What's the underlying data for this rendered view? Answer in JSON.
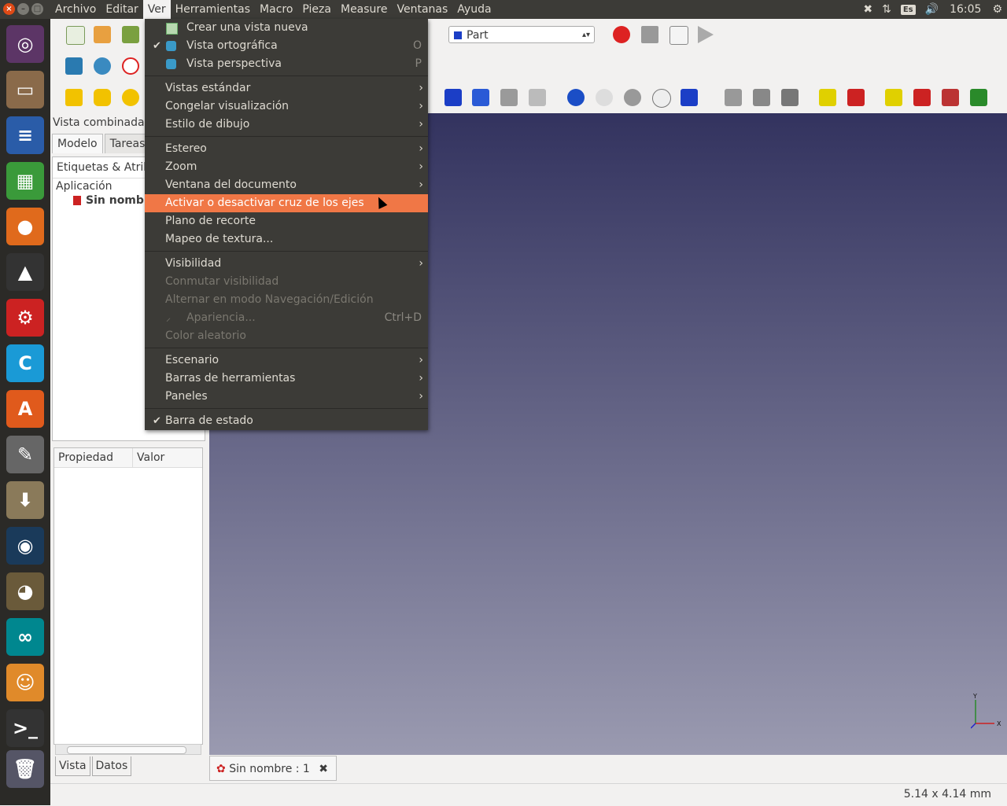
{
  "menubar": {
    "items": [
      "Archivo",
      "Editar",
      "Ver",
      "Herramientas",
      "Macro",
      "Pieza",
      "Measure",
      "Ventanas",
      "Ayuda"
    ],
    "open_item": "Ver"
  },
  "window_controls": {
    "close": "×",
    "minimize": "–",
    "maximize": "□"
  },
  "tray": {
    "keyboard": "Es",
    "clock": "16:05"
  },
  "workbench": {
    "selected": "Part"
  },
  "left_panel": {
    "title": "Vista combinada",
    "tabs": [
      "Modelo",
      "Tareas"
    ],
    "tree_header": "Etiquetas & Atributos",
    "app_label": "Aplicación",
    "doc_label": "Sin nombre",
    "props_headers": [
      "Propiedad",
      "Valor"
    ],
    "bottom_tabs": [
      "Vista",
      "Datos"
    ]
  },
  "doc_tab": {
    "label": "Sin nombre : 1",
    "close": "✖"
  },
  "status": {
    "dimensions": "5.14 x 4.14 mm"
  },
  "axis": {
    "y": "Y",
    "x": "X"
  },
  "ver_menu": [
    {
      "label": "Crear una vista nueva",
      "icon": "new-view-icon"
    },
    {
      "label": "Vista ortográfica",
      "checked": true,
      "icon": "ortho-cube-icon",
      "shortcut": "O"
    },
    {
      "label": "Vista perspectiva",
      "icon": "perspective-cube-icon",
      "shortcut": "P"
    },
    {
      "label": "Vistas estándar",
      "submenu": true
    },
    {
      "label": "Congelar visualización",
      "submenu": true
    },
    {
      "label": "Estilo de dibujo",
      "submenu": true
    },
    {
      "label": "Estereo",
      "submenu": true
    },
    {
      "label": "Zoom",
      "submenu": true
    },
    {
      "label": "Ventana del documento",
      "submenu": true
    },
    {
      "label": "Activar o desactivar cruz de los ejes",
      "highlighted": true
    },
    {
      "label": "Plano de recorte"
    },
    {
      "label": "Mapeo de textura..."
    },
    {
      "label": "Visibilidad",
      "submenu": true
    },
    {
      "label": "Conmutar visibilidad",
      "disabled": true
    },
    {
      "label": "Alternar en modo Navegación/Edición",
      "disabled": true
    },
    {
      "label": "Apariencia...",
      "disabled": true,
      "shortcut": "Ctrl+D",
      "icon": "appearance-brush-icon"
    },
    {
      "label": "Color aleatorio",
      "disabled": true
    },
    {
      "label": "Escenario",
      "submenu": true
    },
    {
      "label": "Barras de herramientas",
      "submenu": true
    },
    {
      "label": "Paneles",
      "submenu": true
    },
    {
      "label": "Barra de estado",
      "checked": true
    }
  ],
  "colors": {
    "highlight": "#f07746",
    "menubar": "#3c3b37",
    "view_top": "#33335f",
    "view_bottom": "#9a9ab0"
  }
}
